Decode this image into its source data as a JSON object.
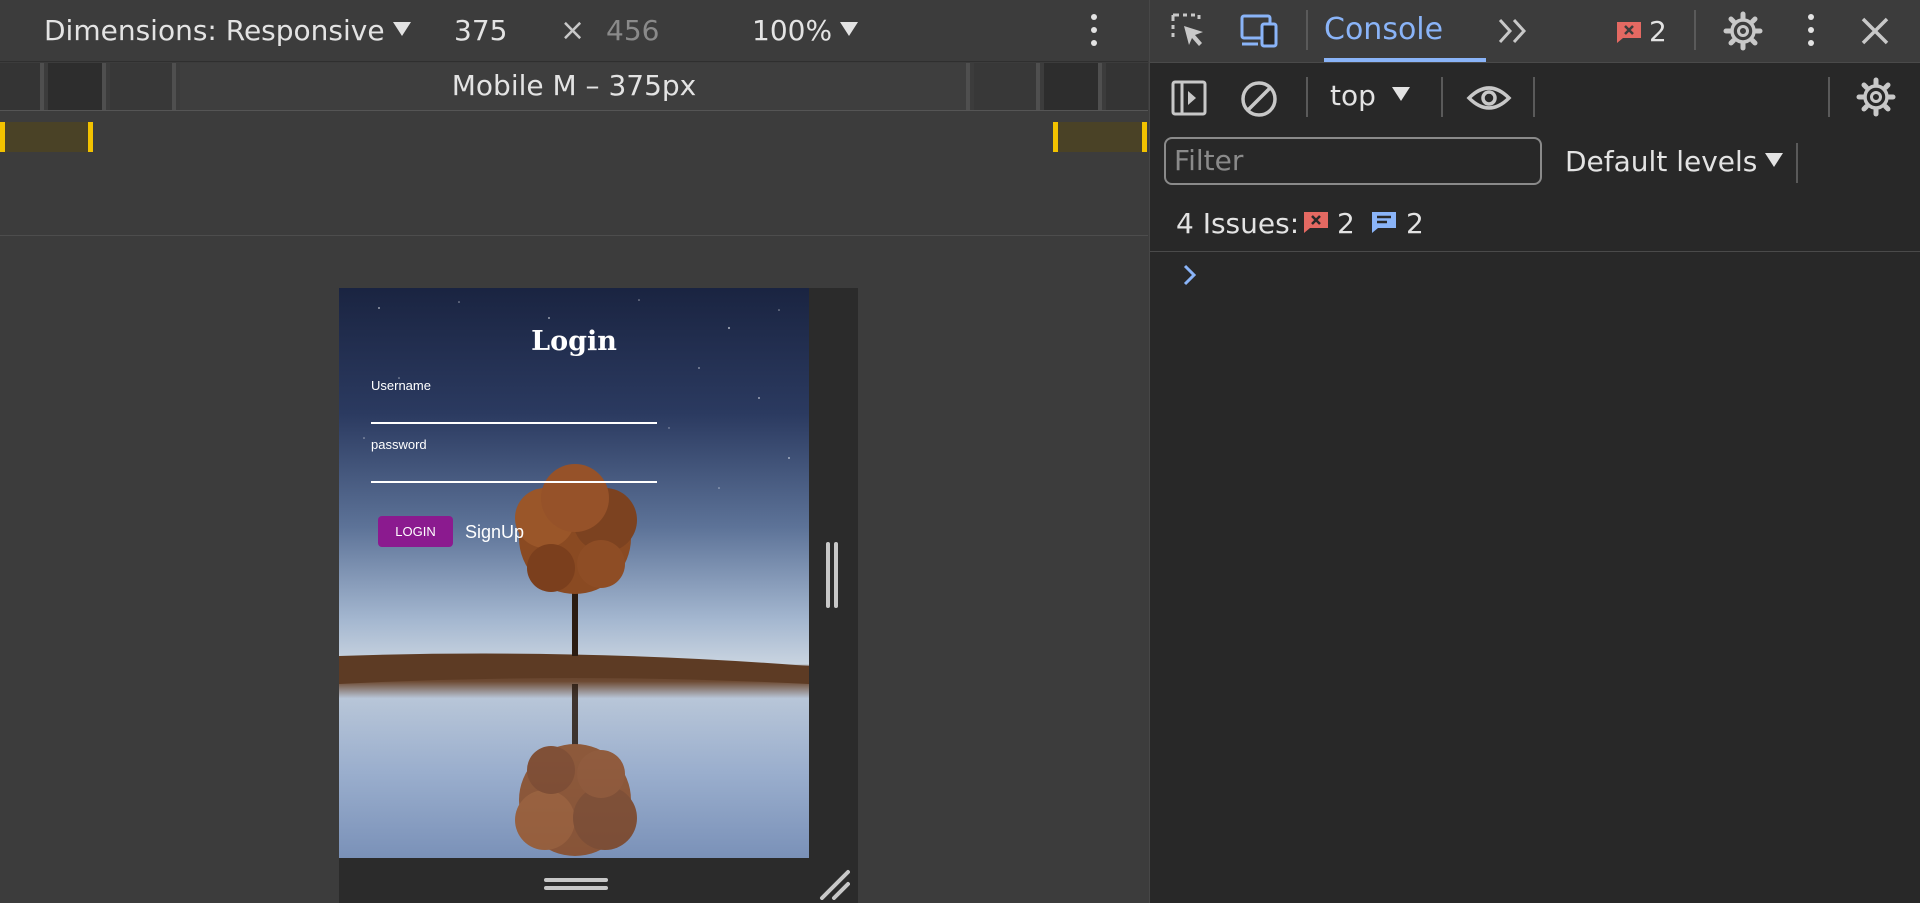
{
  "device_toolbar": {
    "dimensions_label": "Dimensions: Responsive",
    "width": "375",
    "times": "×",
    "height_placeholder": "456",
    "zoom": "100%"
  },
  "media_bar": {
    "device_label": "Mobile M – 375px"
  },
  "emulated_page": {
    "title": "Login",
    "username_label": "Username",
    "password_label": "password",
    "login_button": "LOGIN",
    "signup_link": "SignUp"
  },
  "devtools": {
    "active_tab": "Console",
    "error_count": "2",
    "context": "top",
    "filter_placeholder": "Filter",
    "levels": "Default levels",
    "issues_label": "4 Issues:",
    "issues_errors": "2",
    "issues_info": "2"
  },
  "colors": {
    "accent": "#8ab4f8",
    "error": "#e46962",
    "login_button": "#8b1a8f",
    "ruler_highlight": "#f2c200"
  },
  "icons": [
    "chevron-down-icon",
    "more-vert-icon",
    "inspect-element-icon",
    "device-toggle-icon",
    "more-tabs-icon",
    "error-badge-icon",
    "settings-icon",
    "close-icon",
    "sidebar-toggle-icon",
    "clear-console-icon",
    "live-expression-icon",
    "info-message-icon",
    "prompt-chevron-icon",
    "resize-handle-icon"
  ]
}
